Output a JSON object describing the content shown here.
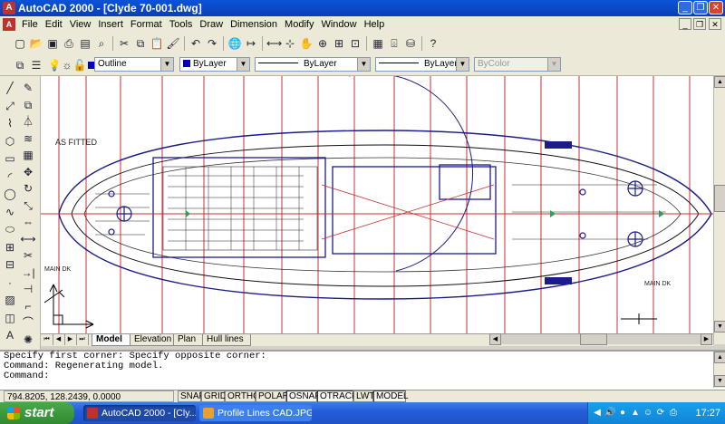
{
  "window": {
    "title": "AutoCAD 2000 - [Clyde 70-001.dwg]",
    "app_icon": "A",
    "minimize_glyph": "_",
    "maximize_glyph": "❐",
    "close_glyph": "✕"
  },
  "menu": {
    "items": [
      "File",
      "Edit",
      "View",
      "Insert",
      "Format",
      "Tools",
      "Draw",
      "Dimension",
      "Modify",
      "Window",
      "Help"
    ],
    "mdi_minimize": "_",
    "mdi_restore": "❐",
    "mdi_close": "✕"
  },
  "standard_toolbar": {
    "icons": [
      "new-icon",
      "open-icon",
      "save-icon",
      "print-icon",
      "print-preview-icon",
      "find-icon",
      "cut-icon",
      "copy-icon",
      "paste-icon",
      "match-properties-icon",
      "undo-icon",
      "redo-icon",
      "hyperlink-icon",
      "ucs-icon",
      "distance-icon",
      "object-snap-icon",
      "pan-icon",
      "zoom-realtime-icon",
      "zoom-window-icon",
      "zoom-previous-icon",
      "properties-icon",
      "design-center-icon",
      "dbconnect-icon",
      "help-icon"
    ],
    "glyphs": [
      "▢",
      "📂",
      "▣",
      "⎙",
      "▤",
      "⌕",
      "✂",
      "⧉",
      "📋",
      "🖌",
      "↶",
      "↷",
      "🌐",
      "↦",
      "⟷",
      "⊹",
      "✋",
      "⊕",
      "⊞",
      "⊡",
      "▦",
      "⌹",
      "⛁",
      "?"
    ]
  },
  "properties_toolbar": {
    "layer_value": "Outline",
    "color_value": "ByLayer",
    "linetype_value": "ByLayer",
    "lineweight_value": "ByLayer",
    "plotstyle_value": "ByColor"
  },
  "left_tools": {
    "draw": [
      "line-icon",
      "construction-line-icon",
      "polyline-icon",
      "polygon-icon",
      "rectangle-icon",
      "arc-icon",
      "circle-icon",
      "spline-icon",
      "ellipse-icon",
      "insert-block-icon",
      "make-block-icon",
      "point-icon",
      "hatch-icon",
      "region-icon",
      "multiline-text-icon"
    ],
    "draw_glyphs": [
      "╱",
      "⤢",
      "⌇",
      "⬡",
      "▭",
      "◜",
      "◯",
      "∿",
      "⬭",
      "⊞",
      "⊟",
      "·",
      "▨",
      "◫",
      "A"
    ],
    "modify": [
      "erase-icon",
      "copy-object-icon",
      "mirror-icon",
      "offset-icon",
      "array-icon",
      "move-icon",
      "rotate-icon",
      "scale-icon",
      "stretch-icon",
      "lengthen-icon",
      "trim-icon",
      "extend-icon",
      "break-icon",
      "chamfer-icon",
      "fillet-icon",
      "explode-icon"
    ],
    "modify_glyphs": [
      "✎",
      "⧉",
      "⏃",
      "≋",
      "▦",
      "✥",
      "↻",
      "⤡",
      "⇔",
      "⟷",
      "✂",
      "→|",
      "⊣",
      "⌐",
      "⌒",
      "✺"
    ]
  },
  "drawing": {
    "annotations": [
      "AS FITTED",
      "MAIN DK",
      "MAIN DK"
    ]
  },
  "layout_tabs": {
    "nav": [
      "⏮",
      "◀",
      "▶",
      "⏭"
    ],
    "tabs": [
      "Model",
      "Elevation",
      "Plan",
      "Hull lines"
    ],
    "active": "Model"
  },
  "scrollbars": {
    "up": "▲",
    "down": "▼",
    "left": "◀",
    "right": "▶"
  },
  "command_window": {
    "lines": [
      "Specify first corner: Specify opposite corner:",
      "Command: Regenerating model.",
      "Command:"
    ]
  },
  "status_bar": {
    "coordinates": "794.8205, 128.2439, 0.0000",
    "toggles": [
      "SNAP",
      "GRID",
      "ORTHO",
      "POLAR",
      "OSNAP",
      "OTRACK",
      "LWT",
      "MODEL"
    ],
    "active_toggles": [
      "OSNAP",
      "OTRACK",
      "MODEL"
    ]
  },
  "taskbar": {
    "start_label": "start",
    "tasks": [
      {
        "label": "AutoCAD 2000 - [Cly...",
        "active": true,
        "icon_color": "#c0302c"
      },
      {
        "label": "Profile Lines CAD.JPG ...",
        "active": false,
        "icon_color": "#e8a030"
      }
    ],
    "tray_icons": [
      "network-icon",
      "volume-icon",
      "antivirus-icon",
      "security-icon",
      "messenger-icon",
      "update-icon",
      "printer-icon"
    ],
    "tray_glyphs": [
      "◀",
      "🔊",
      "●",
      "▲",
      "☺",
      "⟳",
      "⎙"
    ],
    "clock": "17:27"
  }
}
